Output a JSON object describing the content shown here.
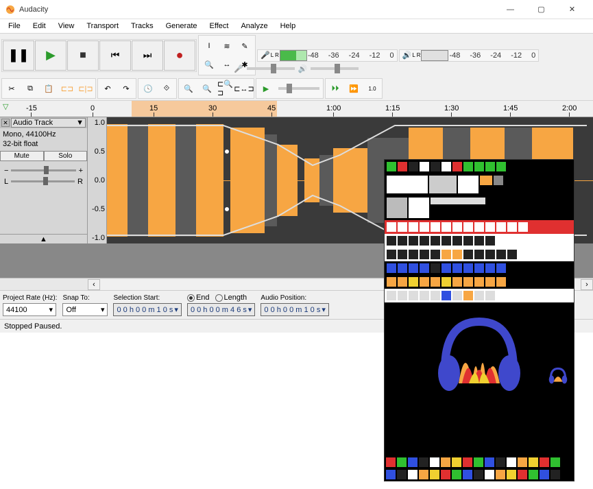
{
  "window": {
    "title": "Audacity",
    "min": "—",
    "max": "▢",
    "close": "✕"
  },
  "menu": [
    "File",
    "Edit",
    "View",
    "Transport",
    "Tracks",
    "Generate",
    "Effect",
    "Analyze",
    "Help"
  ],
  "transport": {
    "pause": "❚❚",
    "play": "▶",
    "stop": "■",
    "start": "⏮",
    "end": "⏭",
    "record": "●"
  },
  "meters": {
    "mic_label": "L R",
    "spk_label": "L R",
    "scale": [
      "-48",
      "-36",
      "-24",
      "-12",
      "0"
    ]
  },
  "ruler": {
    "ticks": [
      {
        "pos": 38,
        "label": "-15"
      },
      {
        "pos": 132,
        "label": "0"
      },
      {
        "pos": 218,
        "label": "15"
      },
      {
        "pos": 304,
        "label": "30"
      },
      {
        "pos": 390,
        "label": "45"
      },
      {
        "pos": 476,
        "label": "1:00"
      },
      {
        "pos": 562,
        "label": "1:15"
      },
      {
        "pos": 648,
        "label": "1:30"
      },
      {
        "pos": 734,
        "label": "1:45"
      },
      {
        "pos": 820,
        "label": "2:00"
      }
    ],
    "sel_start": 192,
    "sel_end": 404
  },
  "track": {
    "name": "Audio Track",
    "dropdown_arrow": "▼",
    "info1": "Mono, 44100Hz",
    "info2": "32-bit float",
    "mute": "Mute",
    "solo": "Solo",
    "gain_left": "−",
    "gain_right": "+",
    "pan_left": "L",
    "pan_right": "R",
    "collapse": "▲",
    "vscale": [
      "1.0",
      "0.5",
      "0.0",
      "-0.5",
      "-1.0"
    ]
  },
  "selection": {
    "rate_label": "Project Rate (Hz):",
    "rate_value": "44100",
    "snap_label": "Snap To:",
    "snap_value": "Off",
    "start_label": "Selection Start:",
    "start_value": "0 0 h 0 0 m 1 0 s",
    "end_label": "End",
    "length_label": "Length",
    "end_value": "0 0 h 0 0 m 4 6 s",
    "audio_pos_label": "Audio Position:",
    "audio_pos_value": "0 0 h 0 0 m 1 0 s"
  },
  "status": "Stopped Paused.",
  "icons": {
    "selection_tool": "I",
    "envelope_tool": "≋",
    "draw_tool": "✎",
    "zoom_tool": "🔍",
    "timeshift_tool": "↔",
    "multi_tool": "✱",
    "cut": "✂",
    "copy": "⧉",
    "paste": "📋",
    "trim": "⊏⊐",
    "silence": "⊏|⊐",
    "undo": "↶",
    "redo": "↷",
    "sync": "🕓",
    "link": "⟐",
    "zoom_in": "🔍+",
    "zoom_out": "🔍−",
    "zoom_sel": "⊏🔍⊐",
    "zoom_fit": "⊏↔⊐",
    "play_region": "▶",
    "mic": "🎤",
    "spk": "🔊",
    "pin": "📌"
  },
  "colors": {
    "wave": "#f7a643",
    "wave_bg": "#3a3a3a",
    "sel": "#f8b878",
    "play_green": "#2c9b2c",
    "record_red": "#c02020",
    "accent_blue": "#3f48cc"
  }
}
